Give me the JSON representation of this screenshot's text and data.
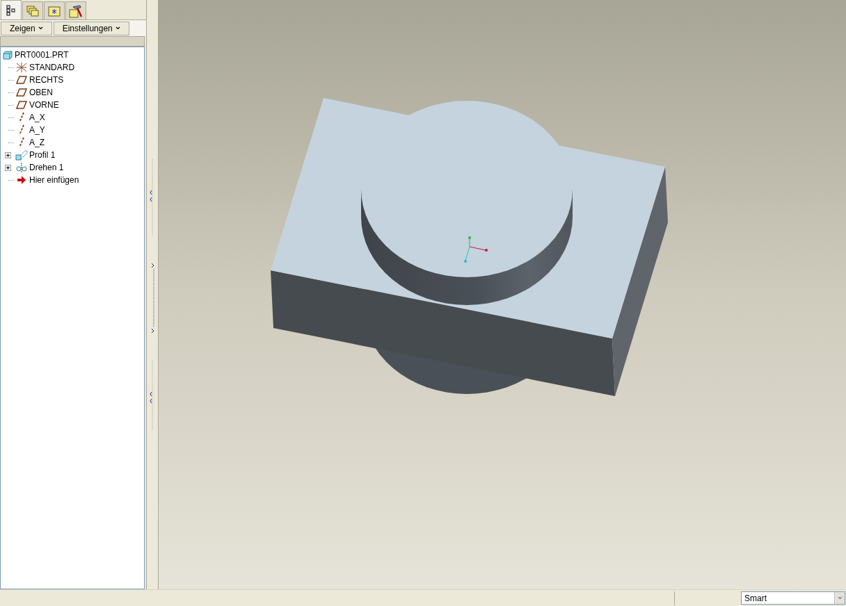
{
  "panel_tabs": [
    {
      "kind": "model-tree",
      "selected": true
    },
    {
      "kind": "layers",
      "selected": false
    },
    {
      "kind": "favorites",
      "selected": false
    },
    {
      "kind": "tools",
      "selected": false
    }
  ],
  "menu_buttons": [
    "Zeigen",
    "Einstellungen"
  ],
  "tree": {
    "label": "PRT0001.PRT",
    "kind": "part",
    "children": [
      {
        "label": "STANDARD",
        "kind": "csys"
      },
      {
        "label": "RECHTS",
        "kind": "plane"
      },
      {
        "label": "OBEN",
        "kind": "plane"
      },
      {
        "label": "VORNE",
        "kind": "plane"
      },
      {
        "label": "A_X",
        "kind": "axis"
      },
      {
        "label": "A_Y",
        "kind": "axis"
      },
      {
        "label": "A_Z",
        "kind": "axis"
      },
      {
        "label": "Profil 1",
        "kind": "extrude",
        "expanded": false
      },
      {
        "label": "Drehen 1",
        "kind": "revolve",
        "expanded": false
      },
      {
        "label": "Hier einfügen",
        "kind": "insert"
      }
    ]
  },
  "status_bar": {
    "filter": "Smart"
  }
}
